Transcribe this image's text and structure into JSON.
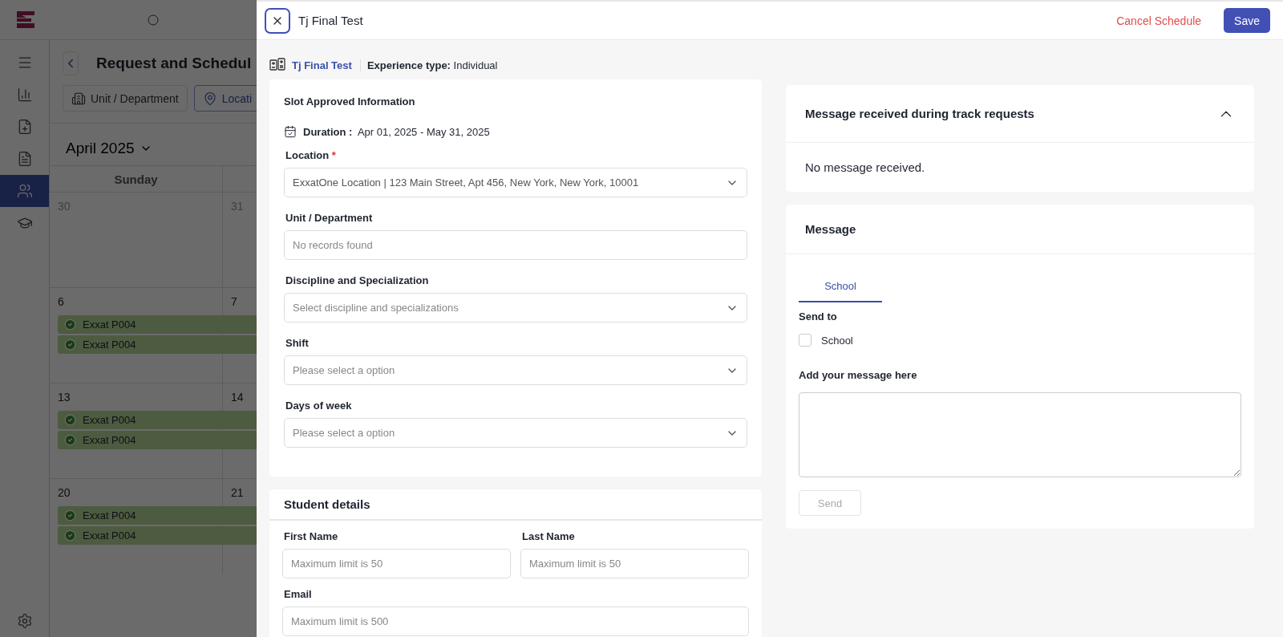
{
  "background": {
    "nav": [
      {
        "selected": false
      },
      {
        "selected": false
      },
      {
        "selected": false
      },
      {
        "selected": false
      },
      {
        "selected": true
      },
      {
        "selected": false
      }
    ],
    "title": "Request and Schedul",
    "filters": [
      {
        "label": "Unit / Department",
        "selected": false
      },
      {
        "label": "Locati",
        "selected": true
      }
    ],
    "month": "April 2025",
    "weekday": "Sunday",
    "weeks": [
      {
        "days": [
          "30",
          "31"
        ]
      },
      {
        "days": [
          "6",
          "7"
        ],
        "events": [
          "Exxat P004",
          "Exxat P004"
        ]
      },
      {
        "days": [
          "13",
          "14"
        ],
        "events": [
          "Exxat P004",
          "Exxat P004"
        ]
      },
      {
        "days": [
          "20",
          "21"
        ],
        "events": [
          "Exxat P004",
          "Exxat P004"
        ]
      }
    ]
  },
  "drawer": {
    "title": "Tj Final Test",
    "cancel": "Cancel Schedule",
    "save": "Save",
    "info": {
      "experience": "Tj Final Test",
      "type_label": "Experience type:",
      "type_value": "Individual"
    },
    "slot": {
      "title": "Slot Approved Information",
      "required_mark": "*",
      "duration_label": "Duration :",
      "duration_value": "Apr 01, 2025 - May 31, 2025",
      "fields": [
        {
          "label": "Location",
          "required": true,
          "kind": "select",
          "value": "ExxatOne Location | 123 Main Street, Apt 456, New York, New York, 10001"
        },
        {
          "label": "Unit / Department",
          "required": false,
          "kind": "input",
          "placeholder": "No records found"
        },
        {
          "label": "Discipline and Specialization",
          "required": false,
          "kind": "select",
          "placeholder": "Select discipline and specializations"
        },
        {
          "label": "Shift",
          "required": false,
          "kind": "select",
          "placeholder": "Please select a option"
        },
        {
          "label": "Days of week",
          "required": false,
          "kind": "select",
          "placeholder": "Please select a option"
        }
      ]
    },
    "student": {
      "title": "Student details",
      "fields": [
        {
          "label": "First Name",
          "placeholder": "Maximum limit is 50",
          "wide": false
        },
        {
          "label": "Last Name",
          "placeholder": "Maximum limit is 50",
          "wide": false
        },
        {
          "label": "Email",
          "placeholder": "Maximum limit is 500",
          "wide": true
        }
      ]
    },
    "received": {
      "title": "Message received during track requests",
      "expanded": true,
      "body": "No message received."
    },
    "message": {
      "title": "Message",
      "tabs": [
        {
          "label": "School",
          "selected": true
        }
      ],
      "send_to": "Send to",
      "recipients": [
        {
          "label": "School",
          "checked": false
        }
      ],
      "input_label": "Add your message here",
      "send": "Send",
      "send_disabled": true
    }
  }
}
